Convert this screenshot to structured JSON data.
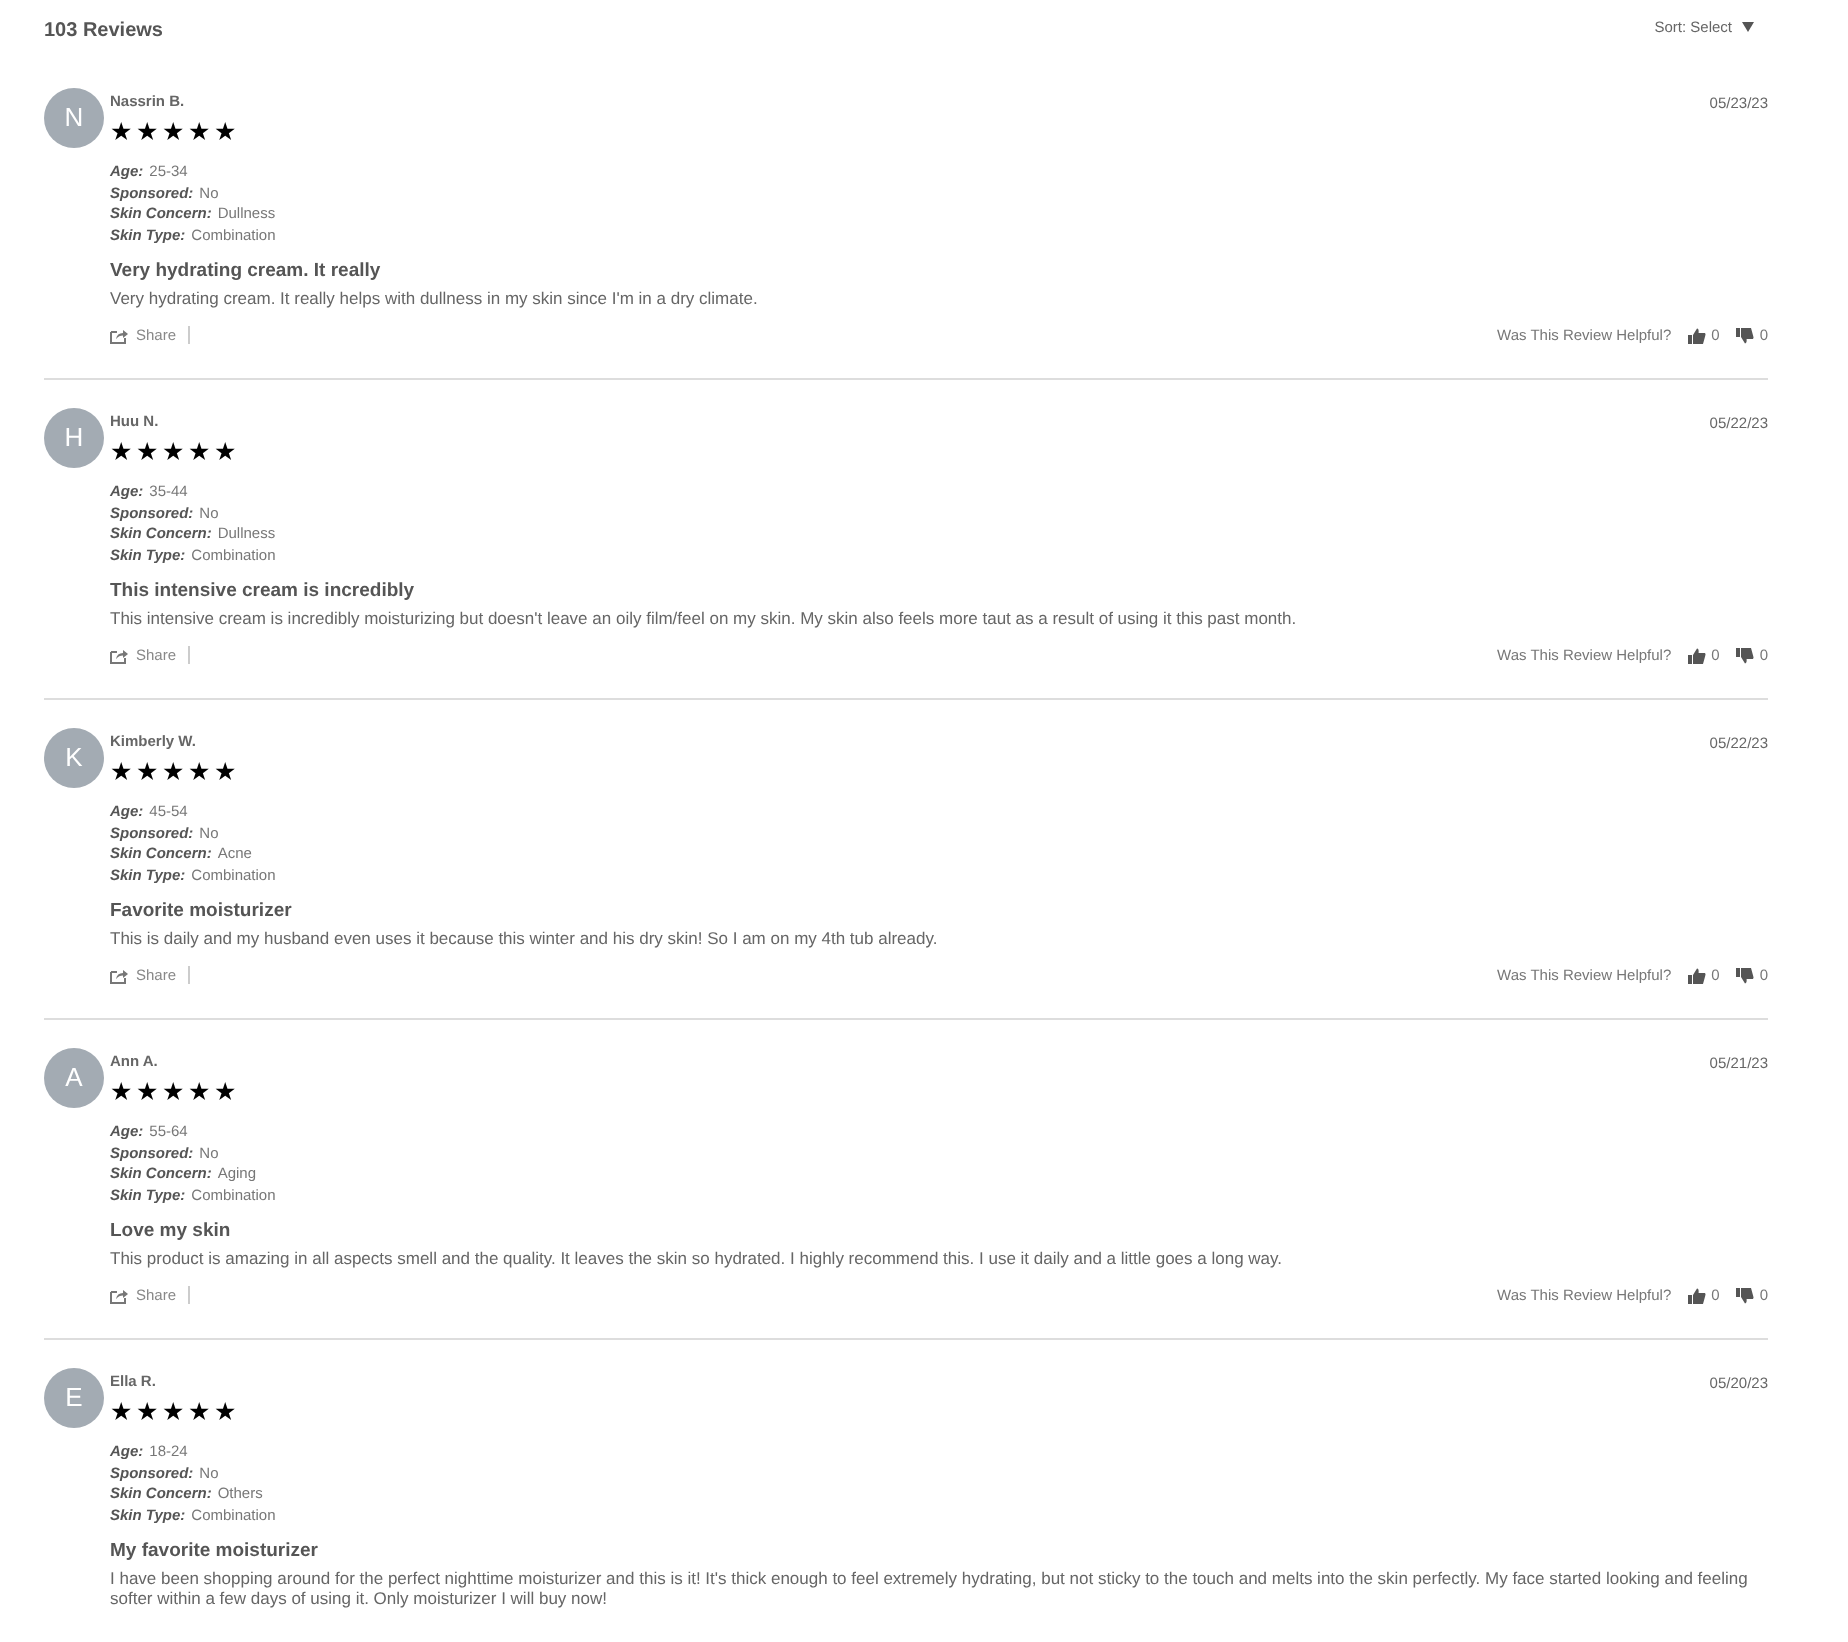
{
  "header": {
    "count": "103 Reviews",
    "sort_label": "Sort: Select"
  },
  "reviews": [
    {
      "initial": "N",
      "name": "Nassrin B.",
      "stars": 5,
      "date": "05/23/23",
      "attributes": [
        {
          "label": "Age:",
          "value": "25-34"
        },
        {
          "label": "Sponsored:",
          "value": "No"
        },
        {
          "label": "Skin Concern:",
          "value": "Dullness"
        },
        {
          "label": "Skin Type:",
          "value": "Combination"
        }
      ],
      "title": "Very hydrating cream. It really",
      "body": "Very hydrating cream. It really helps with dullness in my skin since I'm in a dry climate.",
      "share": "Share",
      "helpful_label": "Was This Review Helpful?",
      "up": "0",
      "down": "0"
    },
    {
      "initial": "H",
      "name": "Huu N.",
      "stars": 5,
      "date": "05/22/23",
      "attributes": [
        {
          "label": "Age:",
          "value": "35-44"
        },
        {
          "label": "Sponsored:",
          "value": "No"
        },
        {
          "label": "Skin Concern:",
          "value": "Dullness"
        },
        {
          "label": "Skin Type:",
          "value": "Combination"
        }
      ],
      "title": "This intensive cream is incredibly",
      "body": "This intensive cream is incredibly moisturizing but doesn't leave an oily film/feel on my skin. My skin also feels more taut as a result of using it this past month.",
      "share": "Share",
      "helpful_label": "Was This Review Helpful?",
      "up": "0",
      "down": "0"
    },
    {
      "initial": "K",
      "name": "Kimberly W.",
      "stars": 5,
      "date": "05/22/23",
      "attributes": [
        {
          "label": "Age:",
          "value": "45-54"
        },
        {
          "label": "Sponsored:",
          "value": "No"
        },
        {
          "label": "Skin Concern:",
          "value": "Acne"
        },
        {
          "label": "Skin Type:",
          "value": "Combination"
        }
      ],
      "title": "Favorite moisturizer",
      "body": "This is daily and my husband even uses it because this winter and his dry skin! So I am on my 4th tub already.",
      "share": "Share",
      "helpful_label": "Was This Review Helpful?",
      "up": "0",
      "down": "0"
    },
    {
      "initial": "A",
      "name": "Ann A.",
      "stars": 5,
      "date": "05/21/23",
      "attributes": [
        {
          "label": "Age:",
          "value": "55-64"
        },
        {
          "label": "Sponsored:",
          "value": "No"
        },
        {
          "label": "Skin Concern:",
          "value": "Aging"
        },
        {
          "label": "Skin Type:",
          "value": "Combination"
        }
      ],
      "title": "Love my skin",
      "body": "This product is amazing in all aspects smell and the quality. It leaves the skin so hydrated. I highly recommend this. I use it daily and a little goes a long way.",
      "share": "Share",
      "helpful_label": "Was This Review Helpful?",
      "up": "0",
      "down": "0"
    },
    {
      "initial": "E",
      "name": "Ella R.",
      "stars": 5,
      "date": "05/20/23",
      "attributes": [
        {
          "label": "Age:",
          "value": "18-24"
        },
        {
          "label": "Sponsored:",
          "value": "No"
        },
        {
          "label": "Skin Concern:",
          "value": "Others"
        },
        {
          "label": "Skin Type:",
          "value": "Combination"
        }
      ],
      "title": "My favorite moisturizer",
      "body": "I have been shopping around for the perfect nighttime moisturizer and this is it! It's thick enough to feel extremely hydrating, but not sticky to the touch and melts into the skin perfectly. My face started looking and feeling softer within a few days of using it. Only moisturizer I will buy now!"
    }
  ]
}
